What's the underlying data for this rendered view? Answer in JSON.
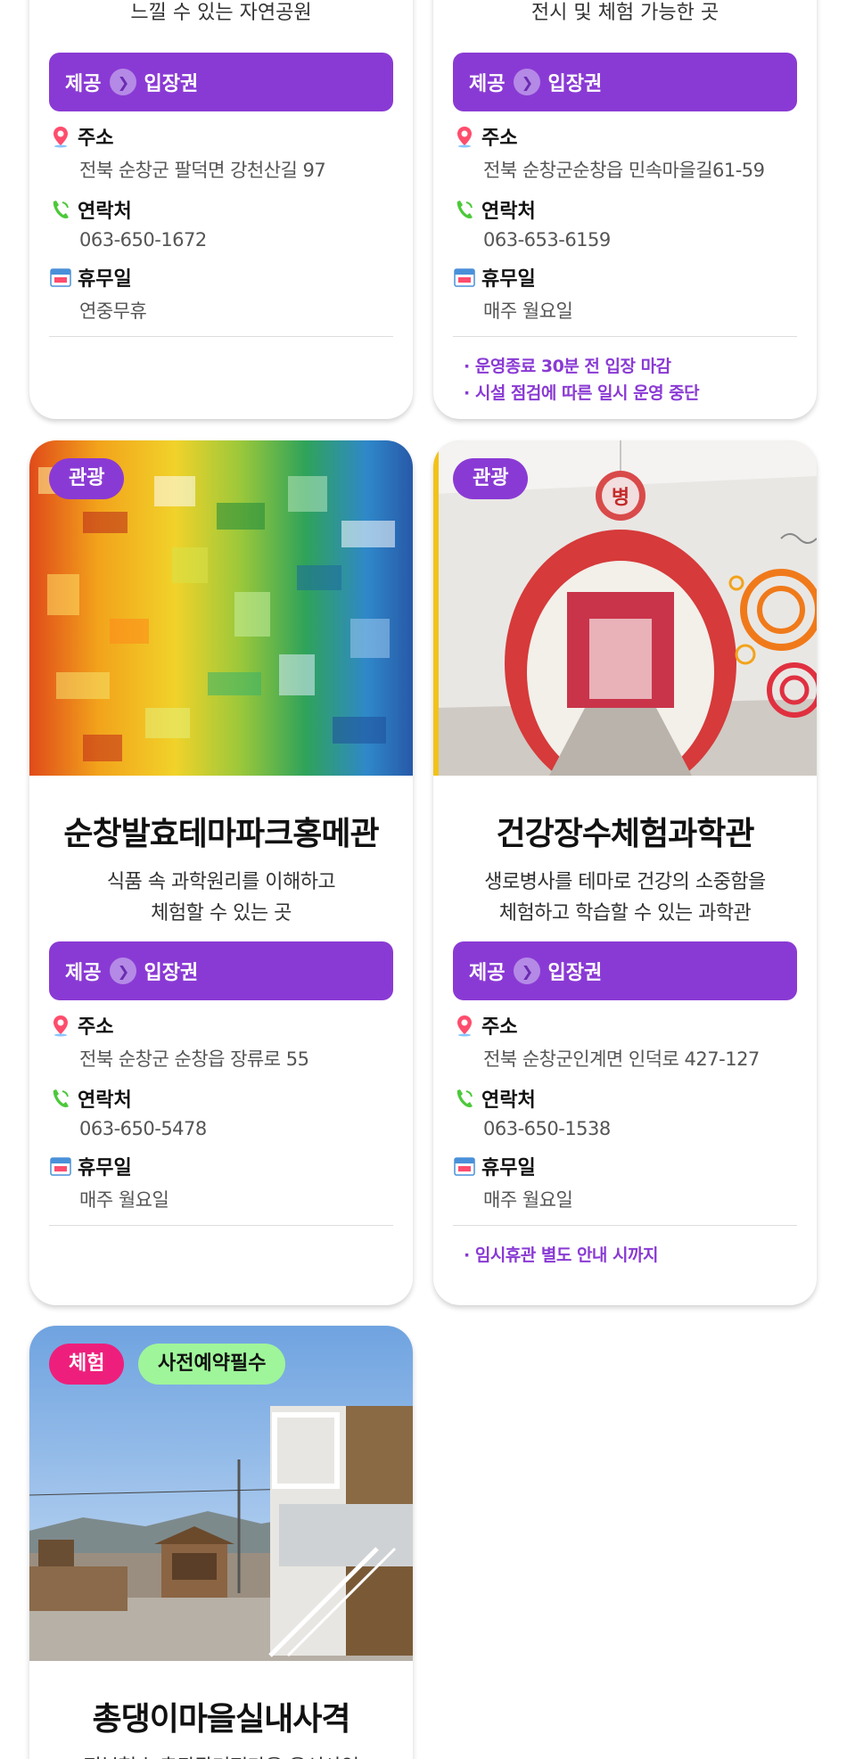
{
  "cards": [
    {
      "desc_tail": "느낄 수 있는 자연공원",
      "provide_label": "제공",
      "provide_value": "입장권",
      "address_label": "주소",
      "address": "전북 순창군 팔덕면 강천산길 97",
      "contact_label": "연락처",
      "contact": "063-650-1672",
      "closed_label": "휴무일",
      "closed": "연중무휴",
      "notes": []
    },
    {
      "desc_tail": "전시 및 체험 가능한 곳",
      "provide_label": "제공",
      "provide_value": "입장권",
      "address_label": "주소",
      "address": "전북 순창군순창읍 민속마을길61-59",
      "contact_label": "연락처",
      "contact": "063-653-6159",
      "closed_label": "휴무일",
      "closed": "매주 월요일",
      "notes": [
        "· 운영종료 30분 전 입장 마감",
        "· 시설 점검에 따른 일시 운영 중단"
      ]
    },
    {
      "tags": [
        "관광"
      ],
      "title": "순창발효테마파크홍메관",
      "desc": [
        "식품 속 과학원리를 이해하고",
        "체험할 수 있는 곳"
      ],
      "provide_label": "제공",
      "provide_value": "입장권",
      "address_label": "주소",
      "address": "전북 순창군 순창읍 장류로 55",
      "contact_label": "연락처",
      "contact": "063-650-5478",
      "closed_label": "휴무일",
      "closed": "매주 월요일",
      "notes": []
    },
    {
      "tags": [
        "관광"
      ],
      "title": "건강장수체험과학관",
      "desc": [
        "생로병사를 테마로 건강의 소중함을",
        "체험하고 학습할 수 있는 과학관"
      ],
      "provide_label": "제공",
      "provide_value": "입장권",
      "address_label": "주소",
      "address": "전북 순창군인계면 인덕로 427-127",
      "contact_label": "연락처",
      "contact": "063-650-1538",
      "closed_label": "휴무일",
      "closed": "매주 월요일",
      "notes": [
        "· 임시휴관 별도 안내 시까지"
      ]
    },
    {
      "tags": [
        "체험",
        "사전예약필수"
      ],
      "title": "총댕이마을실내사격",
      "desc": [
        "전북형 농촌관광거점마을 육성사업"
      ]
    }
  ],
  "photo_texts": {
    "hospital_sign": "병"
  },
  "colors": {
    "purple": "#8a3ad4",
    "tag_purple": "#8a3ad4",
    "tag_pink": "#ee1f7c",
    "tag_green": "#9ff59a"
  }
}
